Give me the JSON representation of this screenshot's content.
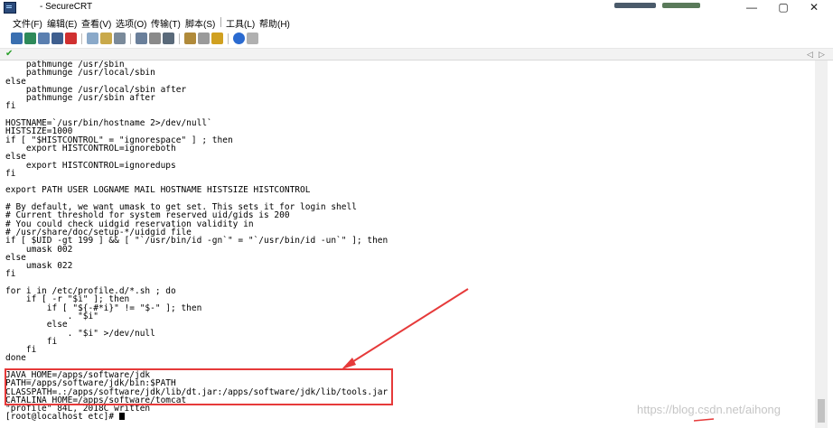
{
  "window": {
    "title": "- SecureCRT",
    "controls": {
      "minimize": "—",
      "maximize": "▢",
      "close": "✕"
    }
  },
  "menu": [
    "文件(F)",
    "编辑(E)",
    "查看(V)",
    "选项(O)",
    "传输(T)",
    "脚本(S)",
    "工具(L)",
    "帮助(H)"
  ],
  "tab": {
    "status_icon": "check-icon",
    "scroll_left": "◁",
    "scroll_right": "▷"
  },
  "terminal": {
    "lines_before": "    pathmunge /usr/sbin\n    pathmunge /usr/local/sbin\nelse\n    pathmunge /usr/local/sbin after\n    pathmunge /usr/sbin after\nfi\n\nHOSTNAME=`/usr/bin/hostname 2>/dev/null`\nHISTSIZE=1000\nif [ \"$HISTCONTROL\" = \"ignorespace\" ] ; then\n    export HISTCONTROL=ignoreboth\nelse\n    export HISTCONTROL=ignoredups\nfi\n\nexport PATH USER LOGNAME MAIL HOSTNAME HISTSIZE HISTCONTROL\n\n# By default, we want umask to get set. This sets it for login shell\n# Current threshold for system reserved uid/gids is 200\n# You could check uidgid reservation validity in\n# /usr/share/doc/setup-*/uidgid file\nif [ $UID -gt 199 ] && [ \"`/usr/bin/id -gn`\" = \"`/usr/bin/id -un`\" ]; then\n    umask 002\nelse\n    umask 022\nfi\n\nfor i in /etc/profile.d/*.sh ; do\n    if [ -r \"$i\" ]; then\n        if [ \"${-#*i}\" != \"$-\" ]; then\n            . \"$i\"\n        else\n            . \"$i\" >/dev/null\n        fi\n    fi\ndone\n\n",
    "highlighted_lines": "JAVA_HOME=/apps/software/jdk\nPATH=/apps/software/jdk/bin:$PATH\nCLASSPATH=.:/apps/software/jdk/lib/dt.jar:/apps/software/jdk/lib/tools.jar\nCATALINA_HOME=/apps/software/tomcat",
    "status_line": "\"profile\" 84L, 2018C written",
    "prompt": "[root@localhost etc]# "
  },
  "annotation": {
    "box_color": "#e63a3a",
    "arrow_color": "#e63a3a"
  },
  "watermark": "https://blog.csdn.net/aihong"
}
